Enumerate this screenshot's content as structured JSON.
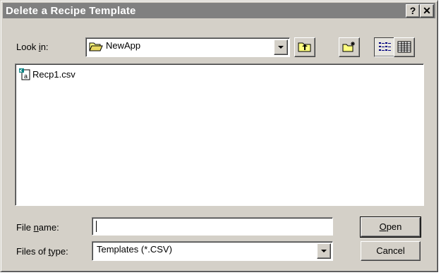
{
  "window": {
    "title": "Delete a Recipe Template"
  },
  "titlebar": {
    "help_label": "?",
    "close_label": "✕"
  },
  "look_in": {
    "label_pre": "Look ",
    "label_u": "i",
    "label_post": "n:",
    "value": "NewApp",
    "icon": "folder-open-icon"
  },
  "toolbar": {
    "icons": [
      "up-folder-icon",
      "new-folder-icon",
      "list-view-icon",
      "details-view-icon"
    ]
  },
  "files": [
    {
      "name": "Recp1.csv",
      "icon": "csv-file-icon"
    }
  ],
  "file_name": {
    "label_pre": "File ",
    "label_u": "n",
    "label_post": "ame:",
    "value": ""
  },
  "file_type": {
    "label_pre": "Files of ",
    "label_u": "t",
    "label_post": "ype:",
    "value": "Templates (*.CSV)"
  },
  "buttons": {
    "open_u": "O",
    "open_rest": "pen",
    "cancel": "Cancel"
  }
}
